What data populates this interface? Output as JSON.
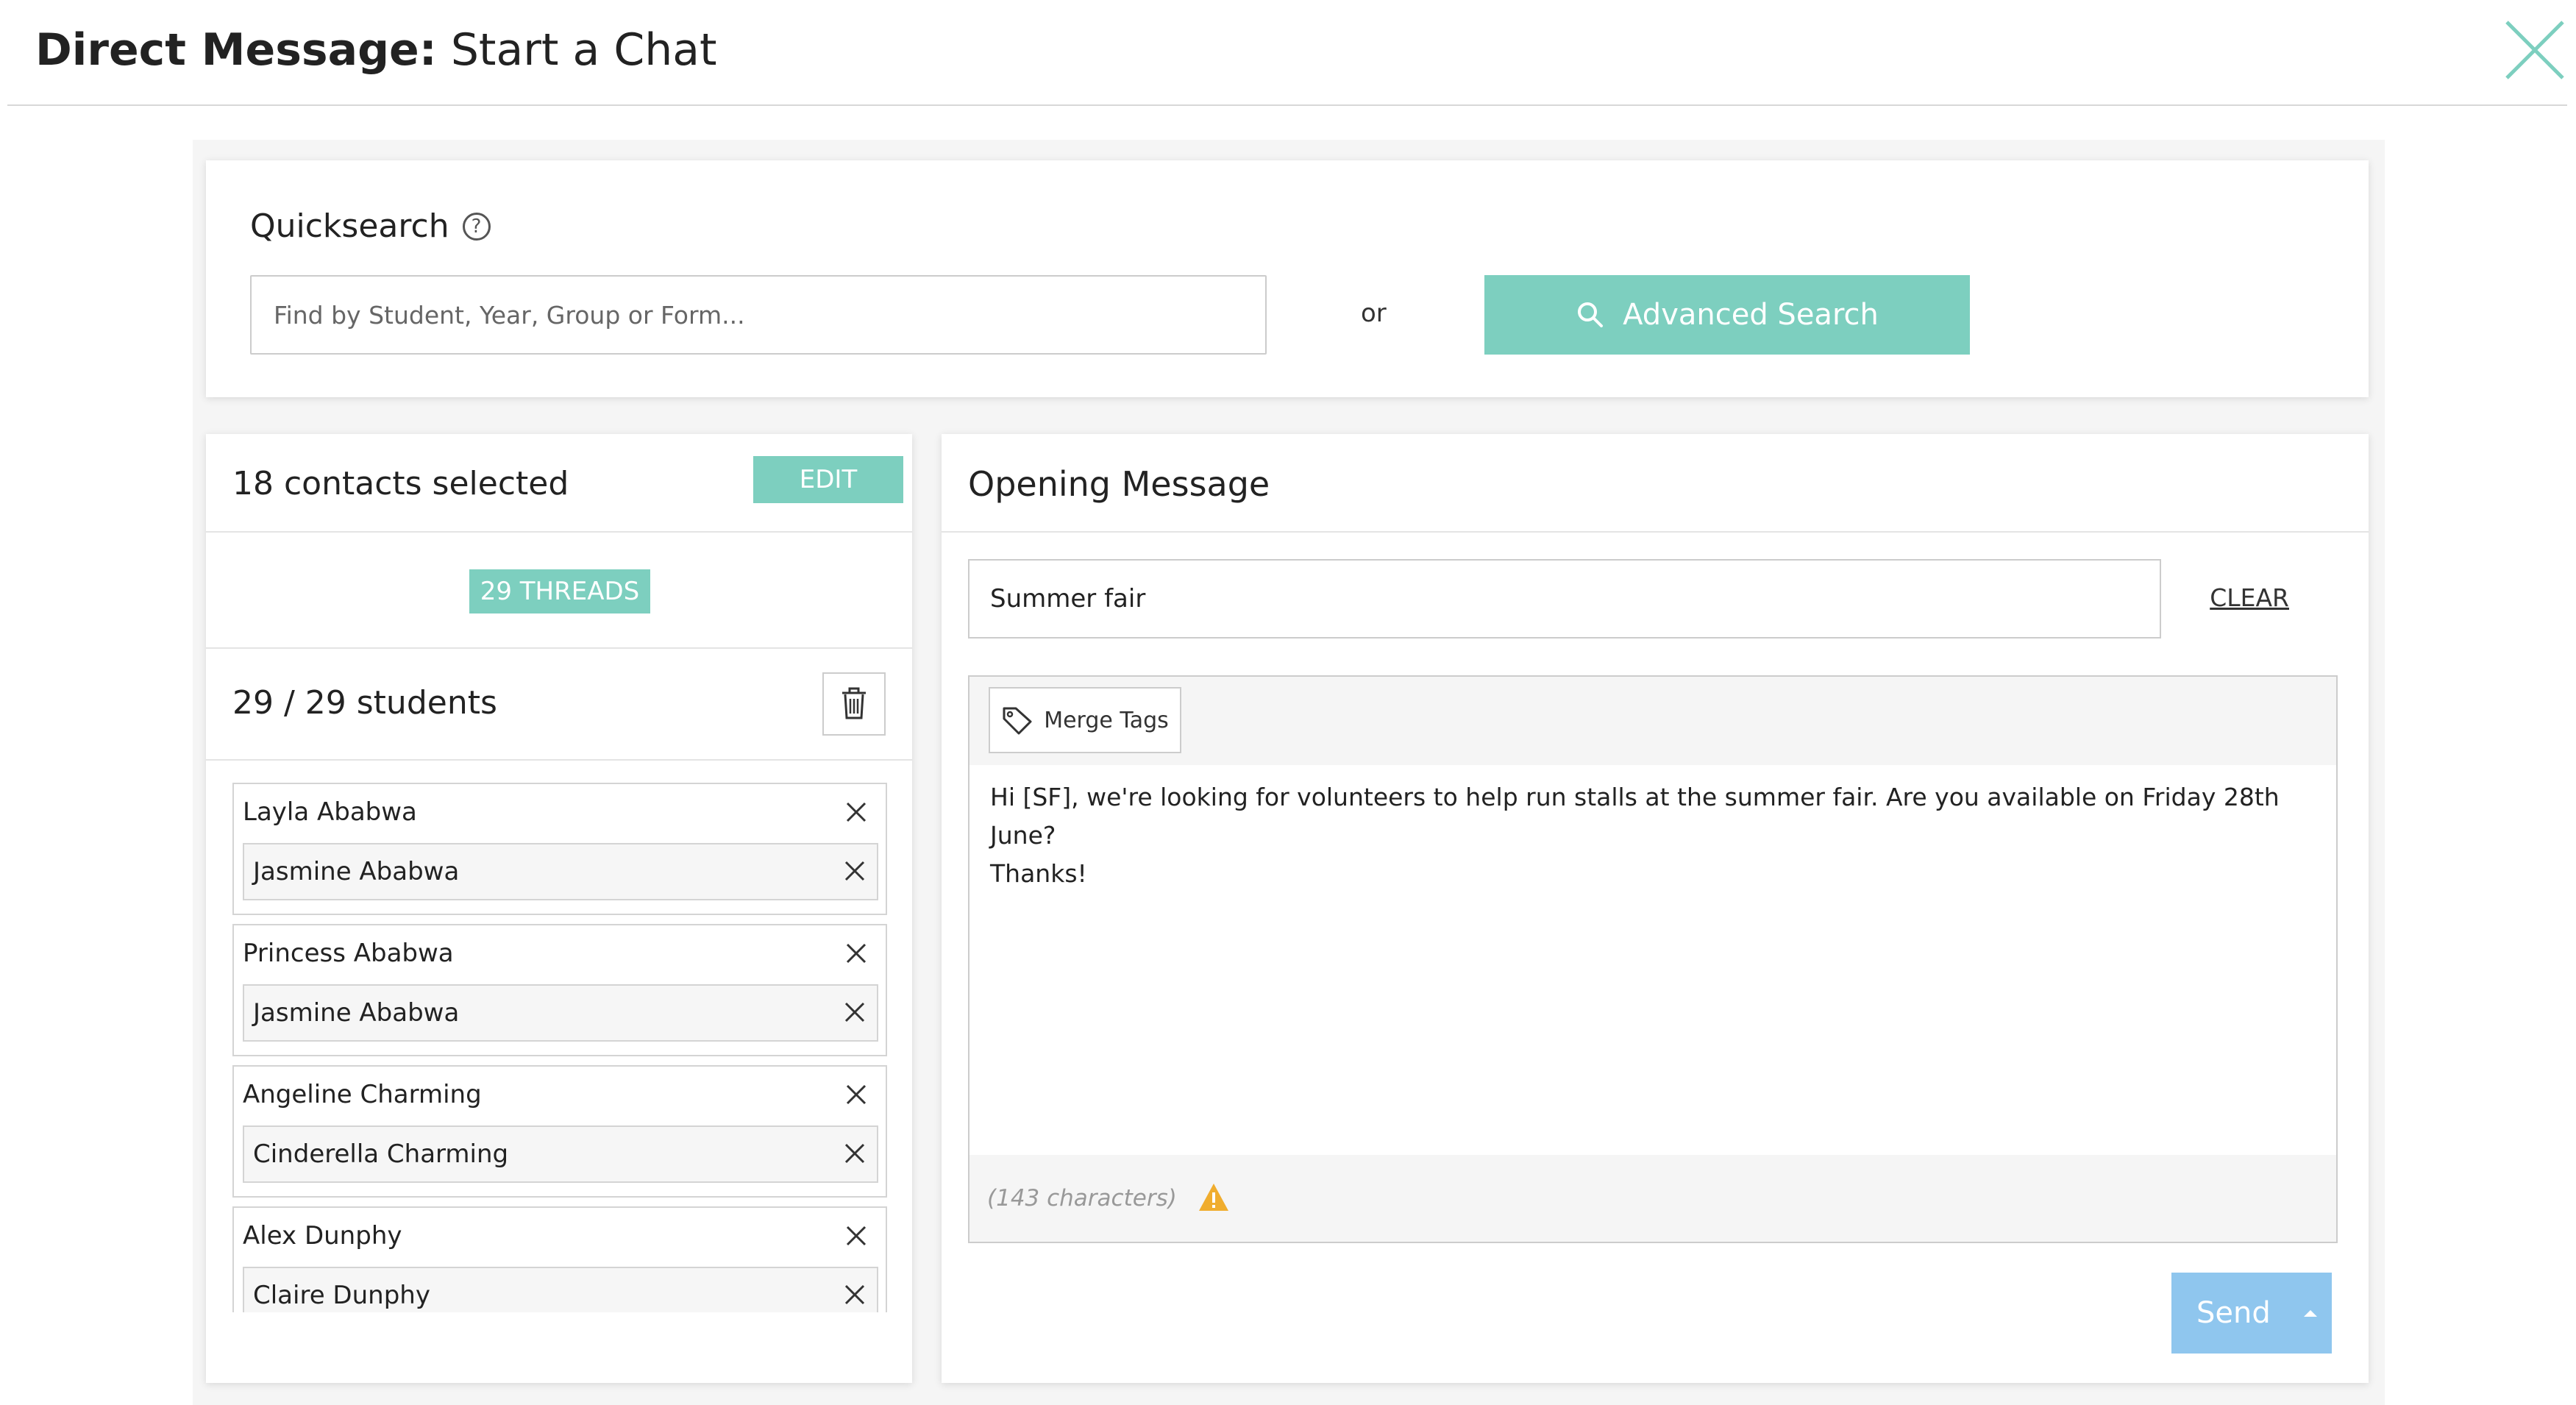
{
  "header": {
    "title_bold": "Direct Message:",
    "title_rest": "Start a Chat"
  },
  "quicksearch": {
    "title": "Quicksearch",
    "help_glyph": "?",
    "placeholder": "Find by Student, Year, Group or Form...",
    "or_text": "or",
    "advanced_button": "Advanced Search"
  },
  "contacts": {
    "selected_label": "18 contacts selected",
    "edit_button": "EDIT",
    "threads_badge": "29 THREADS",
    "students_label": "29 / 29 students",
    "groups": [
      {
        "parent": "Layla Ababwa",
        "child": "Jasmine Ababwa"
      },
      {
        "parent": "Princess Ababwa",
        "child": "Jasmine Ababwa"
      },
      {
        "parent": "Angeline Charming",
        "child": "Cinderella Charming"
      },
      {
        "parent": "Alex Dunphy",
        "child": "Claire Dunphy"
      }
    ]
  },
  "message": {
    "title": "Opening Message",
    "subject_value": "Summer fair",
    "clear_link": "CLEAR",
    "merge_tags_button": "Merge Tags",
    "body_line1": "Hi [SF], we're looking for volunteers to help run stalls at the summer fair. Are you available on Friday 28th June?",
    "body_line2": "Thanks!",
    "char_count": "(143 characters)",
    "send_button": "Send"
  },
  "colors": {
    "accent_teal": "#7dcfbf",
    "send_blue": "#8fc6ee",
    "warning": "#f0ad2e"
  }
}
